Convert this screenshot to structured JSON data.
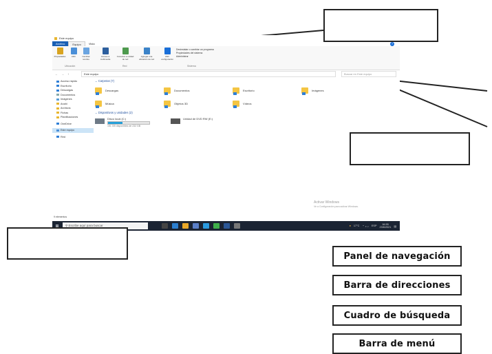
{
  "window": {
    "title": "Este equipo",
    "tabs": [
      "Archivo",
      "Equipo",
      "Vista"
    ],
    "ribbon": {
      "groups": [
        "Ubicación",
        "Red",
        "Sistema"
      ],
      "buttons": [
        "Propiedades",
        "Abrir",
        "Cambiar nombre",
        "Acceso a multimedia",
        "Conectar a unidad de red",
        "Agregar una ubicación de red",
        "Abrir configuración"
      ],
      "system_links": [
        "Desinstalar o cambiar un programa",
        "Propiedades del sistema",
        "Administrar"
      ]
    },
    "address": {
      "path": "Este equipo",
      "search_placeholder": "Buscar en Este equipo"
    },
    "nav_pane": [
      "Acceso rápido",
      "Escritorio",
      "Descargas",
      "Documentos",
      "Imágenes",
      "Anahi",
      "Archivos",
      "Fichas",
      "Planificaciones",
      "OneDrive",
      "Este equipo",
      "Red"
    ],
    "folders_header": "Carpetas (7)",
    "folders": [
      "Descargas",
      "Documentos",
      "Escritorio",
      "Imágenes",
      "Música",
      "Objetos 3D",
      "Vídeos"
    ],
    "drives_header": "Dispositivos y unidades (2)",
    "drives": [
      {
        "name": "Disco local (C:)",
        "space": "151 GB disponibles de 232 GB",
        "used_fraction": 0.35
      },
      {
        "name": "Unidad de DVD RW (E:)",
        "space": ""
      }
    ],
    "status": "9 elementos",
    "watermark_title": "Activar Windows",
    "watermark_sub": "Ve a Configuración para activar Windows."
  },
  "taskbar": {
    "search_placeholder": "Escribe aquí para buscar",
    "weather": "17°C",
    "language": "ESP",
    "time": "16:55",
    "date": "23/6/2021"
  },
  "legend": [
    "Panel de navegación",
    "Barra de direcciones",
    "Cuadro de búsqueda",
    "Barra de menú"
  ]
}
